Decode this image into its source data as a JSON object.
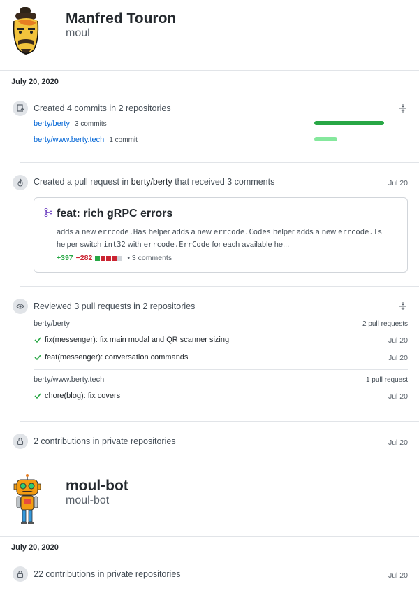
{
  "profiles": [
    {
      "name": "Manfred Touron",
      "login": "moul",
      "date": "July 20, 2020"
    },
    {
      "name": "moul-bot",
      "login": "moul-bot",
      "date": "July 20, 2020"
    }
  ],
  "commits_entry": {
    "title": "Created 4 commits in 2 repositories",
    "repos": [
      {
        "repo": "berty/berty",
        "count": "3 commits",
        "share": 1.0
      },
      {
        "repo": "berty/www.berty.tech",
        "count": "1 commit",
        "share": 0.33
      }
    ]
  },
  "pr_entry": {
    "title_prefix": "Created a pull request in ",
    "title_repo": "berty/berty",
    "title_suffix": " that received 3 comments",
    "date": "Jul 20",
    "card": {
      "title": "feat: rich gRPC errors",
      "body_1": "adds a new ",
      "code_1": "errcode.Has",
      "body_2": " helper adds a new ",
      "code_2": "errcode.Codes",
      "body_3": " helper adds a new ",
      "code_3": "errcode.Is",
      "body_4": " helper switch ",
      "code_4": "int32",
      "body_5": " with ",
      "code_5": "errcode.ErrCode",
      "body_6": " for each available he...",
      "additions": "+397",
      "deletions": "−282",
      "comments": "3 comments"
    }
  },
  "review_entry": {
    "title": "Reviewed 3 pull requests in 2 repositories",
    "groups": [
      {
        "repo": "berty/berty",
        "count": "2 pull requests",
        "items": [
          {
            "title": "fix(messenger): fix main modal and QR scanner sizing",
            "date": "Jul 20"
          },
          {
            "title": "feat(messenger): conversation commands",
            "date": "Jul 20"
          }
        ]
      },
      {
        "repo": "berty/www.berty.tech",
        "count": "1 pull request",
        "items": [
          {
            "title": "chore(blog): fix covers",
            "date": "Jul 20"
          }
        ]
      }
    ]
  },
  "private_entries": [
    {
      "title": "2 contributions in private repositories",
      "date": "Jul 20"
    },
    {
      "title": "22 contributions in private repositories",
      "date": "Jul 20"
    }
  ],
  "colors": {
    "link": "#0366d6",
    "green": "#28a745",
    "light_green": "#85e89d",
    "red": "#cb2431",
    "purple": "#6f42c1"
  },
  "icons": [
    "repo-push-icon",
    "flame-icon",
    "git-pull-request-icon",
    "eye-icon",
    "lock-icon",
    "fold-icon",
    "check-icon"
  ]
}
